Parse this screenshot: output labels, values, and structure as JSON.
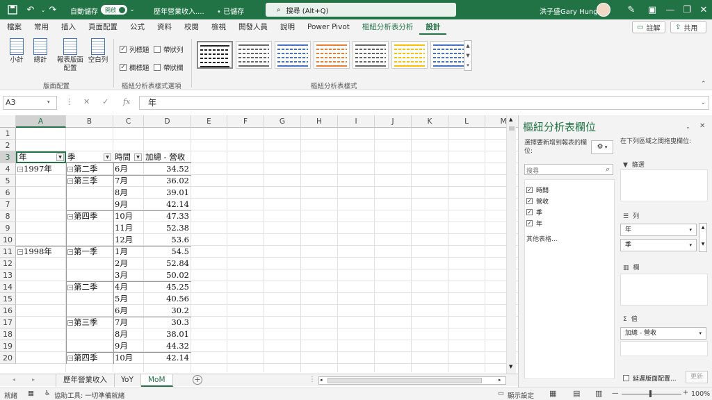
{
  "titlebar": {
    "autosave_label": "自動儲存",
    "autosave_state": "開啟",
    "doc_title": "歷年營業收入....",
    "save_status": "• 已儲存",
    "search_placeholder": "搜尋 (Alt+Q)",
    "user_name": "洪子盛Gary Hung"
  },
  "menu": {
    "tabs": [
      "檔案",
      "常用",
      "插入",
      "頁面配置",
      "公式",
      "資料",
      "校閱",
      "檢視",
      "開發人員",
      "說明",
      "Power Pivot",
      "樞紐分析表分析",
      "設計"
    ],
    "comment_btn": "註解",
    "share_btn": "共用"
  },
  "ribbon": {
    "subtotal": "小計",
    "grandtotal": "總計",
    "report_layout": "報表版面配置",
    "blank_rows": "空白列",
    "layout_group": "版面配置",
    "row_headers": "列標題",
    "banded_rows": "帶狀列",
    "col_headers": "欄標題",
    "banded_cols": "帶狀欄",
    "options_group": "樞紐分析表樣式選項",
    "styles_group": "樞紐分析表樣式",
    "style_colors": [
      "#222222",
      "#666666",
      "#4472c4",
      "#ed7d31",
      "#666666",
      "#ffc000",
      "#4472c4"
    ]
  },
  "formula": {
    "cell_ref": "A3",
    "content": "年"
  },
  "grid": {
    "columns": [
      "A",
      "B",
      "C",
      "D",
      "E",
      "F",
      "G",
      "H",
      "I",
      "J",
      "K",
      "L",
      "M"
    ],
    "rows": [
      "1",
      "2",
      "3",
      "4",
      "5",
      "6",
      "7",
      "8",
      "9",
      "10",
      "11",
      "12",
      "13",
      "14",
      "15",
      "16",
      "17",
      "18",
      "19",
      "20"
    ],
    "header_row": {
      "year": "年",
      "quarter": "季",
      "time": "時間",
      "sum": "加總 - 營收"
    },
    "years": [
      {
        "label": "1997年",
        "row": 4
      },
      {
        "label": "1998年",
        "row": 11
      }
    ],
    "quarters": [
      {
        "label": "第二季",
        "row": 4
      },
      {
        "label": "第三季",
        "row": 5
      },
      {
        "label": "第四季",
        "row": 8
      },
      {
        "label": "第一季",
        "row": 11
      },
      {
        "label": "第二季",
        "row": 14
      },
      {
        "label": "第三季",
        "row": 17
      },
      {
        "label": "第四季",
        "row": 20
      }
    ],
    "data_rows": [
      {
        "month": "6月",
        "value": "34.52"
      },
      {
        "month": "7月",
        "value": "36.02"
      },
      {
        "month": "8月",
        "value": "39.01"
      },
      {
        "month": "9月",
        "value": "42.14"
      },
      {
        "month": "10月",
        "value": "47.33"
      },
      {
        "month": "11月",
        "value": "52.38"
      },
      {
        "month": "12月",
        "value": "53.6"
      },
      {
        "month": "1月",
        "value": "54.5"
      },
      {
        "month": "2月",
        "value": "52.84"
      },
      {
        "month": "3月",
        "value": "50.02"
      },
      {
        "month": "4月",
        "value": "45.25"
      },
      {
        "month": "5月",
        "value": "40.56"
      },
      {
        "month": "6月",
        "value": "30.2"
      },
      {
        "month": "7月",
        "value": "30.3"
      },
      {
        "month": "8月",
        "value": "38.01"
      },
      {
        "month": "9月",
        "value": "44.32"
      },
      {
        "month": "10月",
        "value": "42.14"
      }
    ]
  },
  "sheets": {
    "tabs": [
      "歷年營業收入",
      "YoY",
      "MoM"
    ],
    "active": "MoM"
  },
  "status": {
    "ready": "就緒",
    "accessibility": "協助工具: 一切準備就緒",
    "display_settings": "顯示設定",
    "zoom": "100%"
  },
  "pane": {
    "title": "樞紐分析表欄位",
    "choose_label": "選擇要新增到報表的欄位:",
    "drag_label": "在下列區域之間拖曳欄位:",
    "search_placeholder": "搜尋",
    "fields": [
      "時間",
      "營收",
      "季",
      "年"
    ],
    "more_tables": "其他表格...",
    "filter_label": "篩選",
    "rows_label": "列",
    "row_items": [
      "年",
      "季"
    ],
    "cols_label": "欄",
    "values_label": "值",
    "value_items": [
      "加總 - 營收"
    ],
    "defer_label": "延遲版面配置...",
    "update_btn": "更新"
  }
}
